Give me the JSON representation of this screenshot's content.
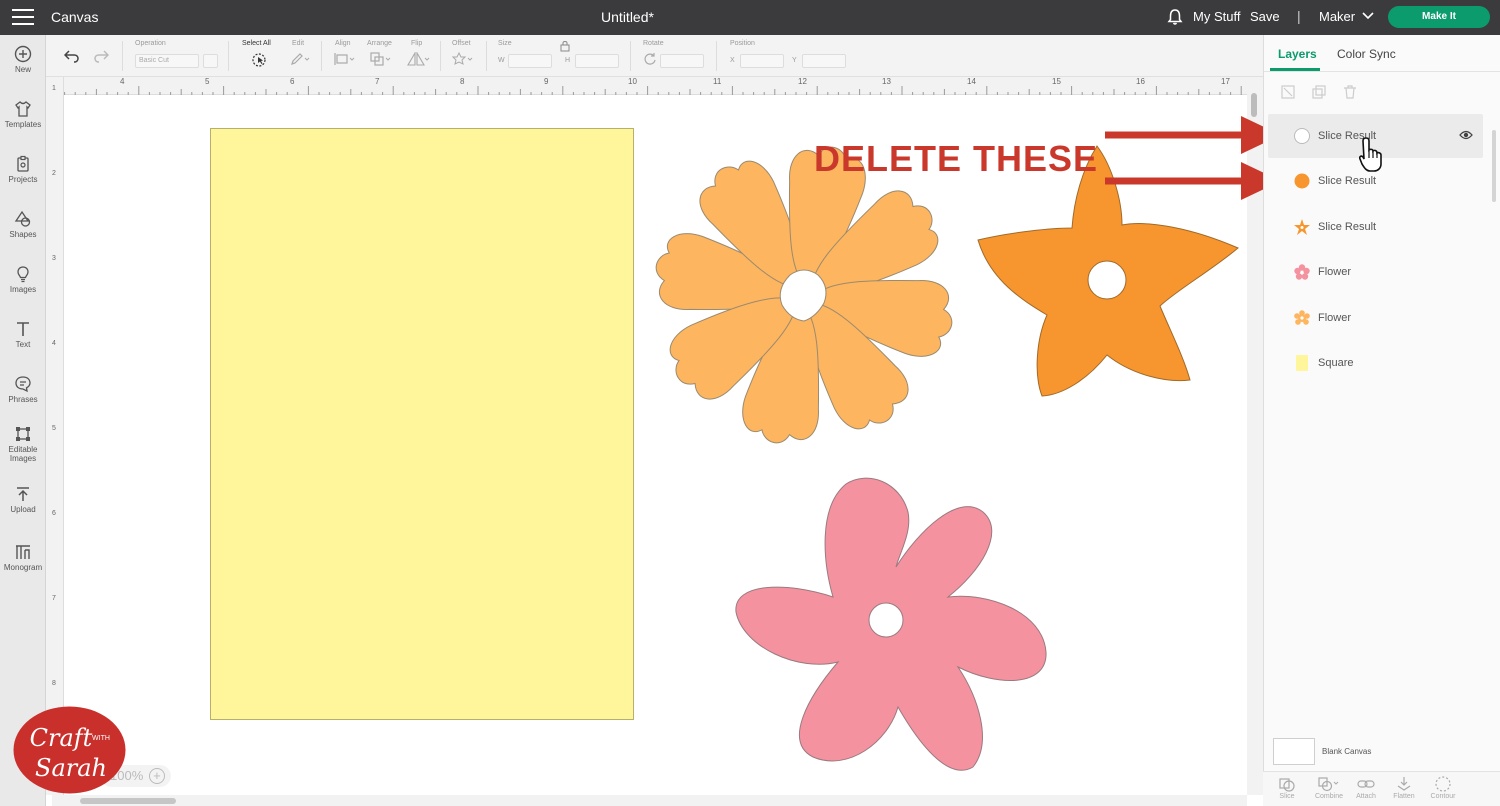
{
  "topbar": {
    "app_name": "Canvas",
    "document_title": "Untitled*",
    "my_stuff": "My Stuff",
    "save": "Save",
    "separator": "|",
    "machine": "Maker",
    "make_it": "Make It"
  },
  "sidebar": {
    "items": [
      {
        "label": "New",
        "icon": "plus-circle-icon"
      },
      {
        "label": "Templates",
        "icon": "shirt-icon"
      },
      {
        "label": "Projects",
        "icon": "projects-icon"
      },
      {
        "label": "Shapes",
        "icon": "shapes-icon"
      },
      {
        "label": "Images",
        "icon": "lightbulb-icon"
      },
      {
        "label": "Text",
        "icon": "text-icon"
      },
      {
        "label": "Phrases",
        "icon": "speech-bubble-icon"
      },
      {
        "label": "Editable Images",
        "icon": "editable-images-icon"
      },
      {
        "label": "Upload",
        "icon": "upload-icon"
      },
      {
        "label": "Monogram",
        "icon": "monogram-icon"
      }
    ]
  },
  "toolbar": {
    "operation_label": "Operation",
    "operation_value": "Basic Cut",
    "select_all": "Select All",
    "edit": "Edit",
    "align": "Align",
    "arrange": "Arrange",
    "flip": "Flip",
    "offset": "Offset",
    "size": "Size",
    "size_w": "W",
    "size_h": "H",
    "rotate": "Rotate",
    "position": "Position",
    "pos_x": "X",
    "pos_y": "Y"
  },
  "rulers": {
    "horizontal": [
      "4",
      "5",
      "6",
      "7",
      "8",
      "9",
      "10",
      "11",
      "12",
      "13",
      "14",
      "15",
      "16",
      "17"
    ],
    "vertical": [
      "1",
      "2",
      "3",
      "4",
      "5",
      "6",
      "7",
      "8"
    ]
  },
  "canvas": {
    "zoom": "100%",
    "annotation": "DELETE THESE",
    "colors": {
      "square": "#fff59b",
      "light_orange_flower": "#fdb55f",
      "orange_flower": "#f7952e",
      "pink_flower": "#f4929f",
      "arrow": "#c9382a"
    }
  },
  "layers_panel": {
    "tabs": [
      "Layers",
      "Color Sync"
    ],
    "layers": [
      {
        "label": "Slice Result",
        "icon": "white-circle-icon",
        "color": "#ffffff",
        "selected": true
      },
      {
        "label": "Slice Result",
        "icon": "orange-circle-icon",
        "color": "#f7952e",
        "selected": false
      },
      {
        "label": "Slice Result",
        "icon": "orange-star-flower-icon",
        "color": "#f7952e",
        "selected": false
      },
      {
        "label": "Flower",
        "icon": "pink-flower-icon",
        "color": "#f4929f",
        "selected": false
      },
      {
        "label": "Flower",
        "icon": "light-orange-flower-icon",
        "color": "#fdb55f",
        "selected": false
      },
      {
        "label": "Square",
        "icon": "yellow-square-icon",
        "color": "#fff59b",
        "selected": false
      }
    ],
    "blank_canvas": "Blank Canvas",
    "bottom_tools": [
      "Slice",
      "Combine",
      "Attach",
      "Flatten",
      "Contour"
    ]
  },
  "watermark": {
    "line1": "Craft",
    "with": "WITH",
    "line2": "Sarah"
  }
}
